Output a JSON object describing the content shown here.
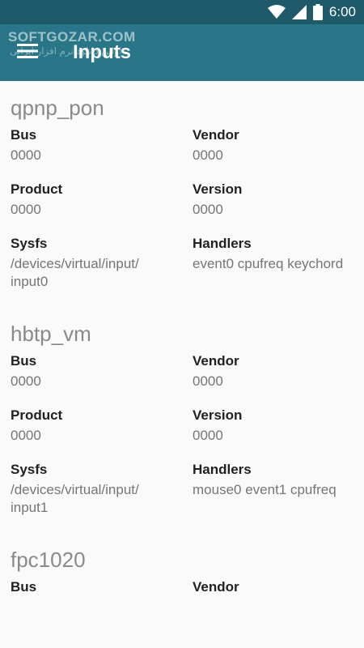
{
  "status_bar": {
    "time": "6:00"
  },
  "app_bar": {
    "title": "Inputs",
    "watermark": "SOFTGOZAR.COM",
    "watermark_sub": "اولین دانلود نرم افزار ایرانی"
  },
  "colors": {
    "status_bar": "#1e5a69",
    "app_bar": "#2a7689",
    "background": "#fafafa"
  },
  "devices": [
    {
      "name": "qpnp_pon",
      "fields": [
        {
          "label": "Bus",
          "value": "0000"
        },
        {
          "label": "Vendor",
          "value": "0000"
        },
        {
          "label": "Product",
          "value": "0000"
        },
        {
          "label": "Version",
          "value": "0000"
        },
        {
          "label": "Sysfs",
          "value": "/devices/virtual/input/\ninput0"
        },
        {
          "label": "Handlers",
          "value": "event0 cpufreq keychord"
        }
      ]
    },
    {
      "name": "hbtp_vm",
      "fields": [
        {
          "label": "Bus",
          "value": "0000"
        },
        {
          "label": "Vendor",
          "value": "0000"
        },
        {
          "label": "Product",
          "value": "0000"
        },
        {
          "label": "Version",
          "value": "0000"
        },
        {
          "label": "Sysfs",
          "value": "/devices/virtual/input/\ninput1"
        },
        {
          "label": "Handlers",
          "value": "mouse0 event1 cpufreq"
        }
      ]
    },
    {
      "name": "fpc1020",
      "fields": [
        {
          "label": "Bus",
          "value": ""
        },
        {
          "label": "Vendor",
          "value": ""
        }
      ]
    }
  ]
}
